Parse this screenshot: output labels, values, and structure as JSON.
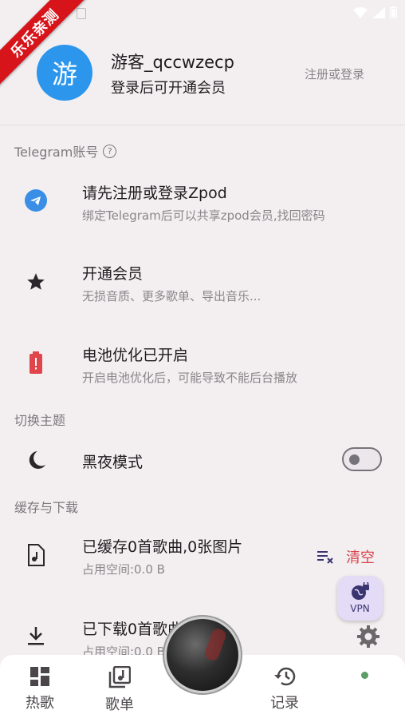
{
  "ribbon": {
    "text": "乐乐亲测"
  },
  "user": {
    "avatar_char": "游",
    "name": "游客_qccwzecp",
    "subtitle": "登录后可开通会员",
    "login_link": "注册或登录"
  },
  "sections": {
    "telegram": "Telegram账号",
    "theme": "切换主题",
    "cache": "缓存与下载"
  },
  "rows": {
    "register": {
      "title": "请先注册或登录Zpod",
      "subtitle": "绑定Telegram后可以共享zpod会员,找回密码"
    },
    "vip": {
      "title": "开通会员",
      "subtitle": "无损音质、更多歌单、导出音乐..."
    },
    "battery": {
      "title": "电池优化已开启",
      "subtitle": "开启电池优化后，可能导致不能后台播放"
    },
    "dark_mode": {
      "title": "黑夜模式",
      "enabled": false
    },
    "cache": {
      "title": "已缓存0首歌曲,0张图片",
      "subtitle": "占用空间:0.0 B",
      "clear_label": "清空"
    },
    "download": {
      "title": "已下载0首歌曲",
      "subtitle": "占用空间:0.0 B"
    }
  },
  "vpn": {
    "label": "VPN"
  },
  "nav": {
    "hot": "热歌",
    "playlist": "歌单",
    "history": "记录"
  },
  "colors": {
    "accent_blue": "#2b96ec",
    "danger_red": "#d9434b",
    "ribbon_red": "#d8141b"
  },
  "icons": [
    "telegram-icon",
    "star-icon",
    "battery-alert-icon",
    "moon-icon",
    "music-file-icon",
    "download-icon",
    "clear-list-icon",
    "vpn-globe-icon",
    "gear-icon",
    "dashboard-icon",
    "music-library-icon",
    "history-icon"
  ]
}
